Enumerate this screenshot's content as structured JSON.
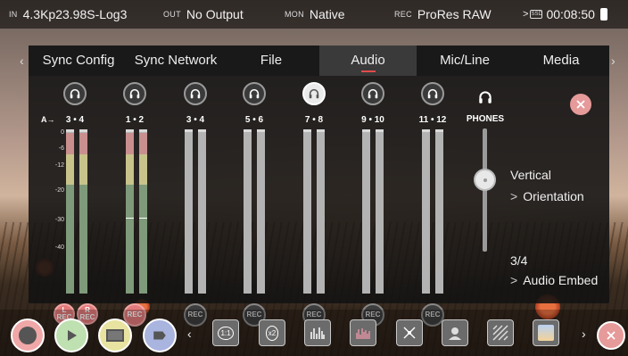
{
  "status": {
    "in_tag": "IN",
    "in_value": "4.3Kp23.98S-Log3",
    "out_tag": "OUT",
    "out_value": "No Output",
    "mon_tag": "MON",
    "mon_value": "Native",
    "rec_tag": "REC",
    "rec_value": "ProRes RAW",
    "chev": ">",
    "sd_label": "SSD",
    "timecode": "00:08:50"
  },
  "tabs": [
    {
      "label": "Sync Config"
    },
    {
      "label": "Sync Network"
    },
    {
      "label": "File"
    },
    {
      "label": "Audio"
    },
    {
      "label": "Mic/Line"
    },
    {
      "label": "Media"
    }
  ],
  "nav": {
    "left": "‹",
    "right": "›"
  },
  "scale": {
    "arrow_label": "A→",
    "ticks": [
      "0",
      "-6",
      "-12",
      "-20",
      "-30",
      "-40"
    ]
  },
  "channels": [
    {
      "pair": "3 • 4",
      "headphones_active": false,
      "rec": "armed",
      "rec_labels": [
        "L REC",
        "R REC"
      ]
    },
    {
      "pair": "1 • 2",
      "headphones_active": false,
      "rec": "armed",
      "rec_labels": [
        "REC"
      ]
    },
    {
      "pair": "3 • 4",
      "headphones_active": false,
      "rec": "off",
      "rec_labels": [
        "REC"
      ]
    },
    {
      "pair": "5 • 6",
      "headphones_active": false,
      "rec": "off",
      "rec_labels": [
        "REC"
      ]
    },
    {
      "pair": "7 • 8",
      "headphones_active": true,
      "rec": "off",
      "rec_labels": [
        "REC"
      ]
    },
    {
      "pair": "9 • 10",
      "headphones_active": false,
      "rec": "off",
      "rec_labels": [
        "REC"
      ]
    },
    {
      "pair": "11 • 12",
      "headphones_active": false,
      "rec": "off",
      "rec_labels": [
        "REC"
      ]
    }
  ],
  "phones": {
    "label": "PHONES"
  },
  "options": {
    "orientation_value": "Vertical",
    "orientation_label": "Orientation",
    "embed_value": "3/4",
    "embed_label": "Audio Embed",
    "gt": ">"
  },
  "toolbar": {
    "tools": [
      "1:1",
      "x2",
      "waveform-icon",
      "vectorscope-icon",
      "false-color-icon",
      "zebra-icon",
      "focus-peak-icon",
      "lut-icon"
    ],
    "chev_left": "‹",
    "chev_right": "›"
  },
  "colors": {
    "accent_red": "#e24b4b",
    "rec_armed": "#e27a7a",
    "play_green": "#bfe0b0",
    "display_yellow": "#e8e3a0",
    "tag_blue": "#a9b4df"
  }
}
